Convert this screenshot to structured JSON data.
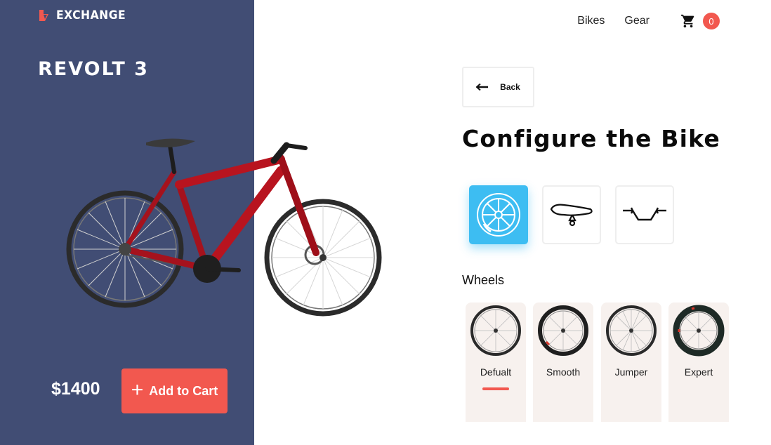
{
  "brand": {
    "name": "EXCHANGE",
    "accent_color": "#f2584f",
    "panel_color": "#414d74"
  },
  "product": {
    "title": "REVOLT 3",
    "price": "$1400",
    "add_to_cart_label": "Add to Cart",
    "image": "red-road-bike"
  },
  "nav": {
    "links": [
      "Bikes",
      "Gear"
    ],
    "cart_count": "0"
  },
  "configurator": {
    "back_label": "Back",
    "title": "Configure the Bike",
    "parts": [
      {
        "icon": "wheel-icon",
        "selected": true
      },
      {
        "icon": "saddle-icon",
        "selected": false
      },
      {
        "icon": "handlebar-icon",
        "selected": false
      }
    ],
    "section_label": "Wheels",
    "wheel_options": [
      {
        "label": "Defualt",
        "selected": true
      },
      {
        "label": "Smooth",
        "selected": false
      },
      {
        "label": "Jumper",
        "selected": false
      },
      {
        "label": "Expert",
        "selected": false
      }
    ]
  }
}
